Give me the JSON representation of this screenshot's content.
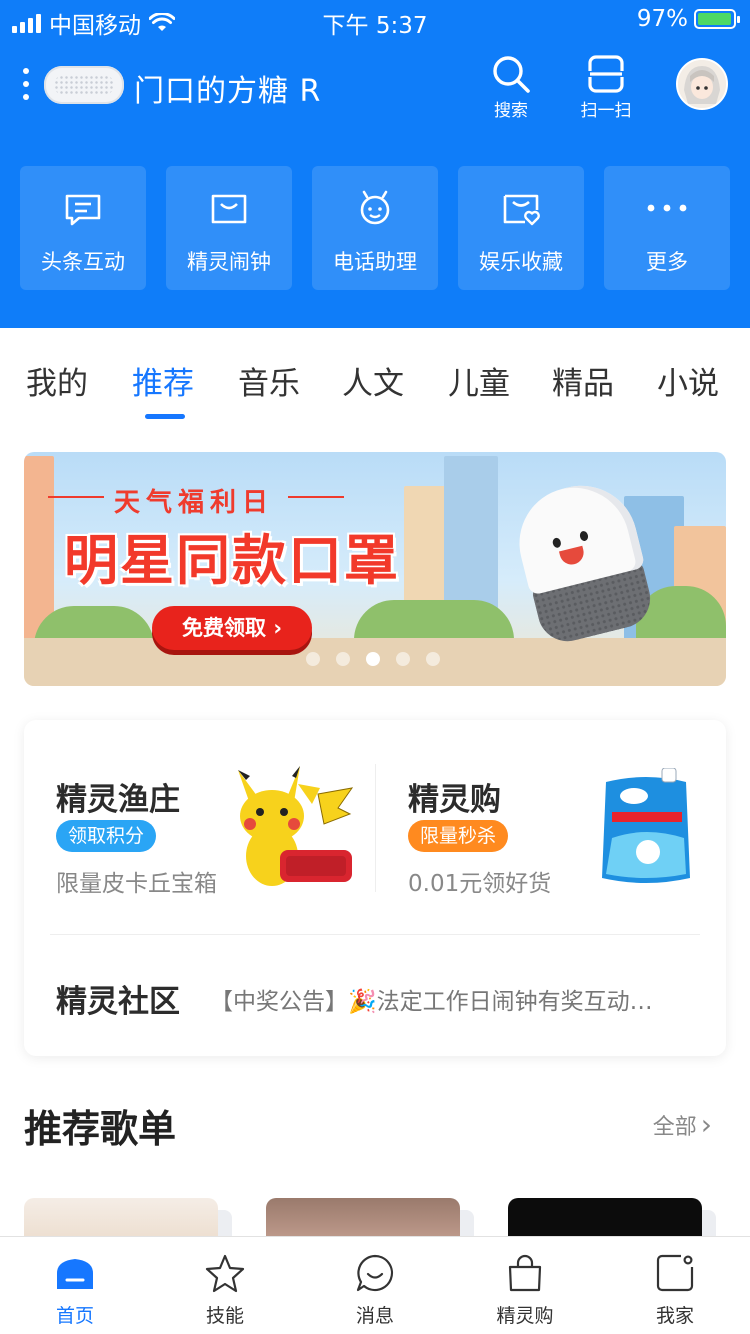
{
  "status_bar": {
    "carrier": "中国移动",
    "time": "下午 5:37",
    "battery_pct": "97%",
    "battery_level": 0.97
  },
  "header": {
    "device_name": "门口的方糖 R",
    "search_label": "搜索",
    "scan_label": "扫一扫"
  },
  "quick_actions": [
    {
      "label": "头条互动",
      "icon": "message-card-icon"
    },
    {
      "label": "精灵闹钟",
      "icon": "alarm-box-icon"
    },
    {
      "label": "电话助理",
      "icon": "robot-face-icon"
    },
    {
      "label": "娱乐收藏",
      "icon": "heart-box-icon"
    },
    {
      "label": "更多",
      "icon": "more-dots-icon"
    }
  ],
  "tabs": [
    {
      "label": "我的"
    },
    {
      "label": "推荐",
      "active": true
    },
    {
      "label": "音乐"
    },
    {
      "label": "人文"
    },
    {
      "label": "儿童"
    },
    {
      "label": "精品"
    },
    {
      "label": "小说"
    }
  ],
  "banner": {
    "subtitle": "天气福利日",
    "headline": "明星同款口罩",
    "cta": "免费领取 ›",
    "slide_count": 5,
    "active_slide": 3
  },
  "service_card": {
    "left": {
      "title": "精灵渔庄",
      "tag": "领取积分",
      "tag_color": "#2aa5f5",
      "desc": "限量皮卡丘宝箱"
    },
    "right": {
      "title": "精灵购",
      "tag": "限量秒杀",
      "tag_color": "#ff8a1f",
      "desc": "0.01元领好货"
    },
    "community": {
      "title": "精灵社区",
      "announcement": "【中奖公告】🎉法定工作日闹钟有奖互动…"
    }
  },
  "playlist_section": {
    "title": "推荐歌单",
    "more": "全部"
  },
  "bottom_nav": [
    {
      "label": "首页",
      "icon": "home-icon",
      "active": true
    },
    {
      "label": "技能",
      "icon": "star-icon"
    },
    {
      "label": "消息",
      "icon": "chat-icon"
    },
    {
      "label": "精灵购",
      "icon": "shopping-bag-icon"
    },
    {
      "label": "我家",
      "icon": "home-device-icon"
    }
  ],
  "colors": {
    "brand_blue": "#0f7df9",
    "active_tab": "#1677ff"
  }
}
